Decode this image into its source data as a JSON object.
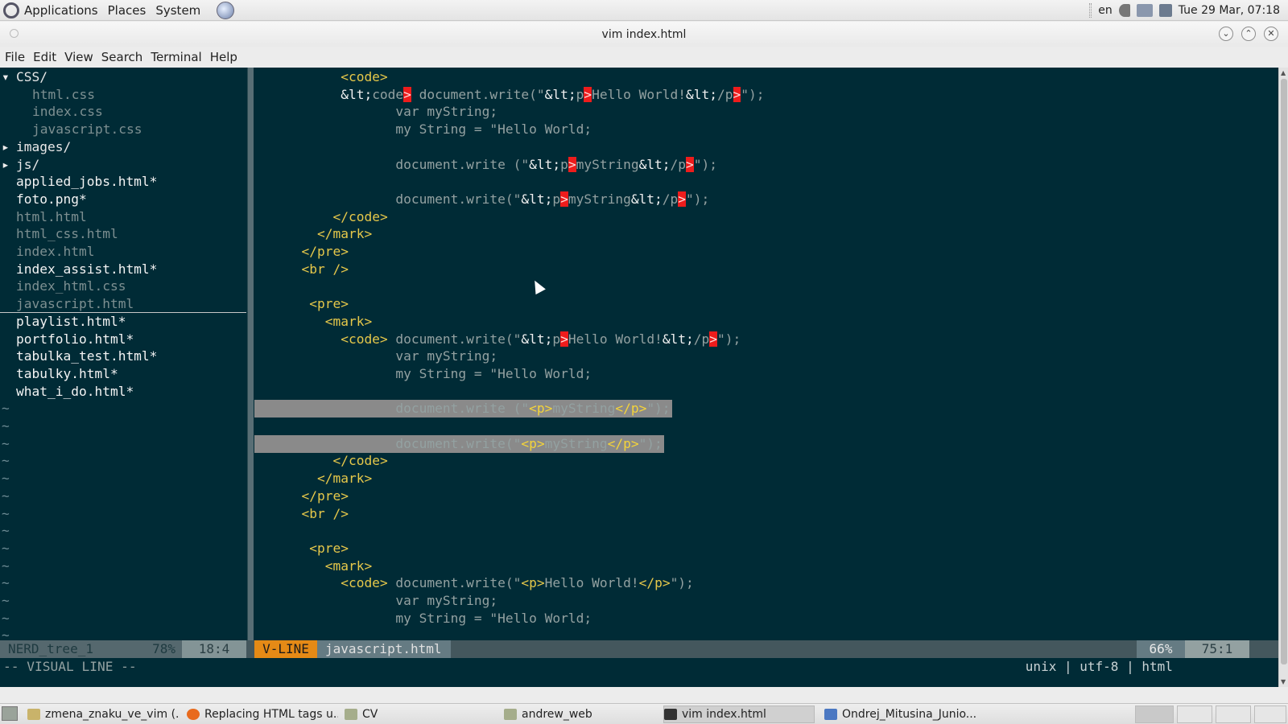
{
  "top_panel": {
    "menus": [
      "Applications",
      "Places",
      "System"
    ],
    "keyboard_layout": "en",
    "clock": "Tue 29 Mar, 07:18"
  },
  "window": {
    "title": "vim index.html"
  },
  "menubar": [
    "File",
    "Edit",
    "View",
    "Search",
    "Terminal",
    "Help"
  ],
  "tree": {
    "entries": [
      {
        "arrow": "▾",
        "name": "CSS/",
        "kind": "dir",
        "indent": 0
      },
      {
        "arrow": "",
        "name": "html.css",
        "kind": "plain",
        "indent": 1
      },
      {
        "arrow": "",
        "name": "index.css",
        "kind": "plain",
        "indent": 1
      },
      {
        "arrow": "",
        "name": "javascript.css",
        "kind": "plain",
        "indent": 1
      },
      {
        "arrow": "▸",
        "name": "images/",
        "kind": "dir",
        "indent": 0
      },
      {
        "arrow": "▸",
        "name": "js/",
        "kind": "dir",
        "indent": 0
      },
      {
        "arrow": "",
        "name": "applied_jobs.html*",
        "kind": "mod",
        "indent": 0
      },
      {
        "arrow": "",
        "name": "foto.png*",
        "kind": "mod",
        "indent": 0
      },
      {
        "arrow": "",
        "name": "html.html",
        "kind": "plain",
        "indent": 0
      },
      {
        "arrow": "",
        "name": "html_css.html",
        "kind": "plain",
        "indent": 0
      },
      {
        "arrow": "",
        "name": "index.html",
        "kind": "plain",
        "indent": 0
      },
      {
        "arrow": "",
        "name": "index_assist.html*",
        "kind": "mod",
        "indent": 0
      },
      {
        "arrow": "",
        "name": "index_html.css",
        "kind": "plain",
        "indent": 0
      },
      {
        "arrow": "",
        "name": "javascript.html",
        "kind": "cursor",
        "indent": 0
      },
      {
        "arrow": "",
        "name": "playlist.html*",
        "kind": "mod",
        "indent": 0
      },
      {
        "arrow": "",
        "name": "portfolio.html*",
        "kind": "mod",
        "indent": 0
      },
      {
        "arrow": "",
        "name": "tabulka_test.html*",
        "kind": "mod",
        "indent": 0
      },
      {
        "arrow": "",
        "name": "tabulky.html*",
        "kind": "mod",
        "indent": 0
      },
      {
        "arrow": "",
        "name": "what_i_do.html*",
        "kind": "mod",
        "indent": 0
      }
    ],
    "tilde": "~",
    "tilde_rows": 14
  },
  "code_lines": [
    {
      "sel": false,
      "segs": [
        [
          "txt",
          "           "
        ],
        [
          "tag",
          "<code>"
        ]
      ]
    },
    {
      "sel": false,
      "segs": [
        [
          "txt",
          "           "
        ],
        [
          "ent",
          "&lt;"
        ],
        [
          "txt",
          "code"
        ],
        [
          "red",
          ">"
        ],
        [
          "txt",
          " document.write(\""
        ],
        [
          "ent",
          "&lt;"
        ],
        [
          "txt",
          "p"
        ],
        [
          "red",
          ">"
        ],
        [
          "txt",
          "Hello World!"
        ],
        [
          "ent",
          "&lt;"
        ],
        [
          "txt",
          "/p"
        ],
        [
          "red",
          ">"
        ],
        [
          "txt",
          "\");"
        ]
      ]
    },
    {
      "sel": false,
      "segs": [
        [
          "txt",
          "                  var myString;"
        ]
      ]
    },
    {
      "sel": false,
      "segs": [
        [
          "txt",
          "                  my String = \"Hello World;"
        ]
      ]
    },
    {
      "sel": false,
      "segs": [
        [
          "txt",
          ""
        ]
      ]
    },
    {
      "sel": false,
      "segs": [
        [
          "txt",
          "                  document.write (\""
        ],
        [
          "ent",
          "&lt;"
        ],
        [
          "txt",
          "p"
        ],
        [
          "red",
          ">"
        ],
        [
          "txt",
          "myString"
        ],
        [
          "ent",
          "&lt;"
        ],
        [
          "txt",
          "/p"
        ],
        [
          "red",
          ">"
        ],
        [
          "txt",
          "\");"
        ]
      ]
    },
    {
      "sel": false,
      "segs": [
        [
          "txt",
          ""
        ]
      ]
    },
    {
      "sel": false,
      "segs": [
        [
          "txt",
          "                  document.write(\""
        ],
        [
          "ent",
          "&lt;"
        ],
        [
          "txt",
          "p"
        ],
        [
          "red",
          ">"
        ],
        [
          "txt",
          "myString"
        ],
        [
          "ent",
          "&lt;"
        ],
        [
          "txt",
          "/p"
        ],
        [
          "red",
          ">"
        ],
        [
          "txt",
          "\");"
        ]
      ]
    },
    {
      "sel": false,
      "segs": [
        [
          "txt",
          "          "
        ],
        [
          "tag",
          "</code>"
        ]
      ]
    },
    {
      "sel": false,
      "segs": [
        [
          "txt",
          "        "
        ],
        [
          "tag",
          "</mark>"
        ]
      ]
    },
    {
      "sel": false,
      "segs": [
        [
          "txt",
          "      "
        ],
        [
          "tag",
          "</pre>"
        ]
      ]
    },
    {
      "sel": false,
      "segs": [
        [
          "txt",
          "      "
        ],
        [
          "tag",
          "<br />"
        ]
      ]
    },
    {
      "sel": false,
      "segs": [
        [
          "txt",
          ""
        ]
      ]
    },
    {
      "sel": false,
      "segs": [
        [
          "txt",
          "       "
        ],
        [
          "tag",
          "<pre>"
        ]
      ]
    },
    {
      "sel": false,
      "segs": [
        [
          "txt",
          "         "
        ],
        [
          "tag",
          "<mark>"
        ]
      ]
    },
    {
      "sel": false,
      "segs": [
        [
          "txt",
          "           "
        ],
        [
          "tag",
          "<code>"
        ],
        [
          "txt",
          " document.write(\""
        ],
        [
          "ent",
          "&lt;"
        ],
        [
          "txt",
          "p"
        ],
        [
          "red",
          ">"
        ],
        [
          "txt",
          "Hello World!"
        ],
        [
          "ent",
          "&lt;"
        ],
        [
          "txt",
          "/p"
        ],
        [
          "red",
          ">"
        ],
        [
          "txt",
          "\");"
        ]
      ]
    },
    {
      "sel": false,
      "segs": [
        [
          "txt",
          "                  var myString;"
        ]
      ]
    },
    {
      "sel": false,
      "segs": [
        [
          "txt",
          "                  my String = \"Hello World;"
        ]
      ]
    },
    {
      "sel": false,
      "segs": [
        [
          "txt",
          ""
        ]
      ]
    },
    {
      "sel": true,
      "segs": [
        [
          "txt",
          "                  document.write (\""
        ],
        [
          "tag",
          "<p>"
        ],
        [
          "txt",
          "myString"
        ],
        [
          "tag",
          "</p>"
        ],
        [
          "txt",
          "\");"
        ]
      ]
    },
    {
      "sel": true,
      "segs": [
        [
          "txt",
          ""
        ]
      ]
    },
    {
      "sel": true,
      "segs": [
        [
          "txt",
          "                  document.write(\""
        ],
        [
          "tag",
          "<p>"
        ],
        [
          "txt",
          "myString"
        ],
        [
          "tag",
          "</p>"
        ],
        [
          "txt",
          "\");"
        ]
      ]
    },
    {
      "sel": false,
      "segs": [
        [
          "txt",
          "          "
        ],
        [
          "tag",
          "</code>"
        ]
      ]
    },
    {
      "sel": false,
      "segs": [
        [
          "txt",
          "        "
        ],
        [
          "tag",
          "</mark>"
        ]
      ]
    },
    {
      "sel": false,
      "segs": [
        [
          "txt",
          "      "
        ],
        [
          "tag",
          "</pre>"
        ]
      ]
    },
    {
      "sel": false,
      "segs": [
        [
          "txt",
          "      "
        ],
        [
          "tag",
          "<br />"
        ]
      ]
    },
    {
      "sel": false,
      "segs": [
        [
          "txt",
          ""
        ]
      ]
    },
    {
      "sel": false,
      "segs": [
        [
          "txt",
          "       "
        ],
        [
          "tag",
          "<pre>"
        ]
      ]
    },
    {
      "sel": false,
      "segs": [
        [
          "txt",
          "         "
        ],
        [
          "tag",
          "<mark>"
        ]
      ]
    },
    {
      "sel": false,
      "segs": [
        [
          "txt",
          "           "
        ],
        [
          "tag",
          "<code>"
        ],
        [
          "txt",
          " document.write(\""
        ],
        [
          "tag",
          "<p>"
        ],
        [
          "txt",
          "Hello World!"
        ],
        [
          "tag",
          "</p>"
        ],
        [
          "txt",
          "\");"
        ]
      ]
    },
    {
      "sel": false,
      "segs": [
        [
          "txt",
          "                  var myString;"
        ]
      ]
    },
    {
      "sel": false,
      "segs": [
        [
          "txt",
          "                  my String = \"Hello World;"
        ]
      ]
    }
  ],
  "statusline": {
    "tree_name": "NERD_tree_1",
    "tree_percent": "78%",
    "tree_pos": "18:4",
    "mode": "V-LINE",
    "file": "javascript.html",
    "fileformat": "unix",
    "encoding": "utf-8",
    "filetype": "html",
    "percent": "66%",
    "position": "75:1",
    "sep": "|"
  },
  "cmdline": "-- VISUAL LINE --",
  "colors": {
    "terminal_bg": "#002b36",
    "mode_bg": "#e58a16",
    "tag": "#e6c84a",
    "error_hl": "#ee1c1c"
  },
  "taskbar": {
    "tasks": [
      {
        "label": "zmena_znaku_ve_vim (...",
        "icon": "text-editor-icon"
      },
      {
        "label": "Replacing HTML tags u...",
        "icon": "firefox-icon"
      },
      {
        "label": "CV",
        "icon": "folder-icon"
      },
      {
        "label": "andrew_web",
        "icon": "folder-icon"
      },
      {
        "label": "vim index.html",
        "icon": "terminal-icon"
      },
      {
        "label": "Ondrej_Mitusina_Junio...",
        "icon": "document-icon"
      }
    ]
  }
}
